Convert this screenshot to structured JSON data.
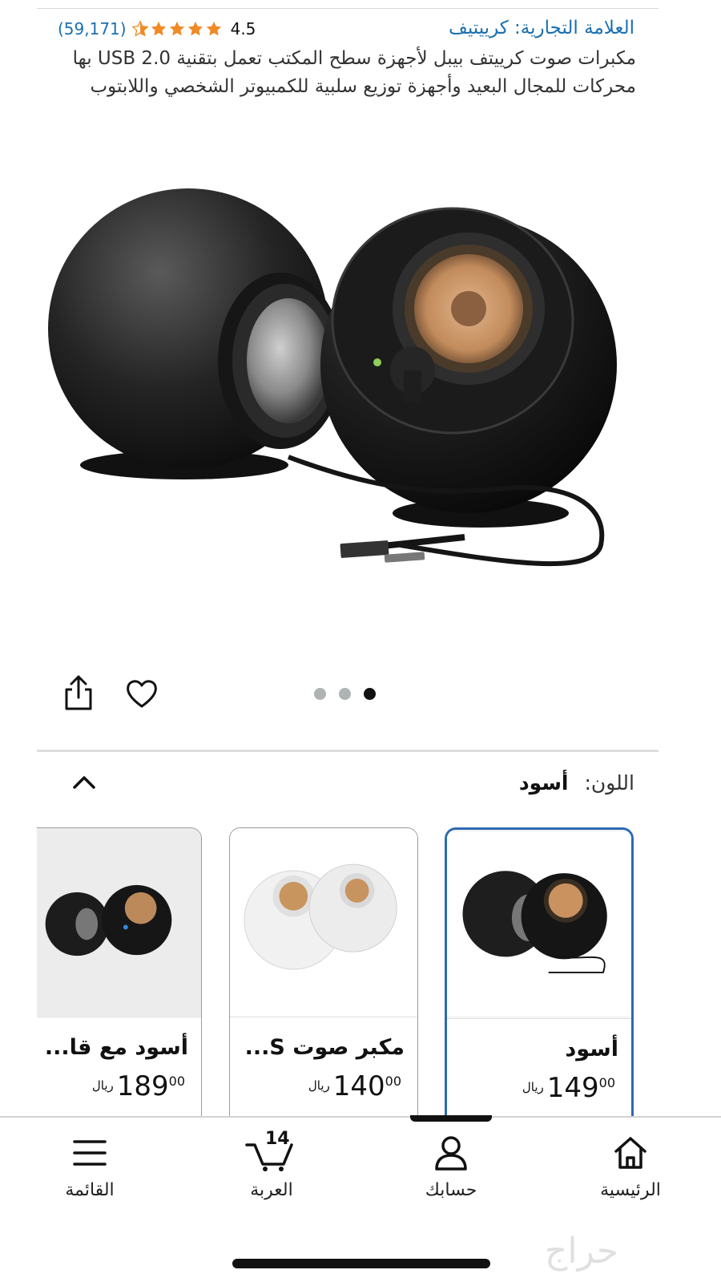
{
  "header": {
    "brand": "العلامة التجارية: كرييتيف",
    "rating_value": "4.5",
    "rating_count": "(59,171)",
    "title": "مكبرات صوت كرييتف بيبل لأجهزة سطح المكتب تعمل بتقنية USB 2.0 بها محركات للمجال البعيد وأجهزة توزيع سلبية للكمبيوتر الشخصي واللابتوب"
  },
  "gallery": {
    "image_count": 3,
    "active_index": 2,
    "share_icon": "share-icon",
    "favorite_icon": "heart-icon"
  },
  "color": {
    "label": "اللون:",
    "selected": "أسود",
    "options": [
      {
        "name": "أسود",
        "currency": "ريال",
        "price_int": "149",
        "price_frac": "00"
      },
      {
        "name": "مكبر صوت S...",
        "currency": "ريال",
        "price_int": "140",
        "price_frac": "00"
      },
      {
        "name": "أسود مع قا...",
        "currency": "ريال",
        "price_int": "189",
        "price_frac": "00"
      }
    ]
  },
  "nav": {
    "home": "الرئيسية",
    "account": "حسابك",
    "cart": "العربة",
    "cart_count": "14",
    "menu": "القائمة"
  },
  "watermark": "حراج",
  "colors": {
    "link": "#1a6fb0",
    "star": "#f08a24",
    "selected_border": "#2d6ab0"
  }
}
